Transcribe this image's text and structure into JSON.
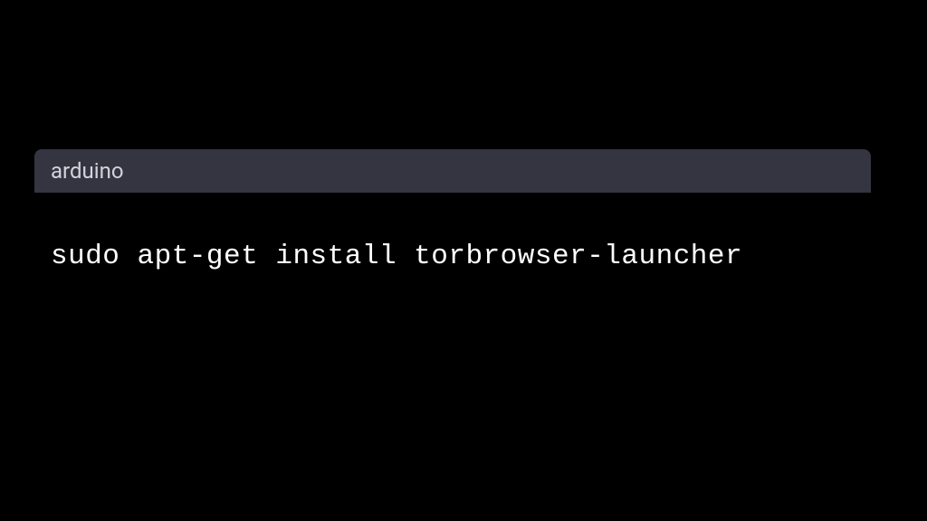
{
  "codeBlock": {
    "language": "arduino",
    "code": "sudo apt-get install torbrowser-launcher"
  }
}
